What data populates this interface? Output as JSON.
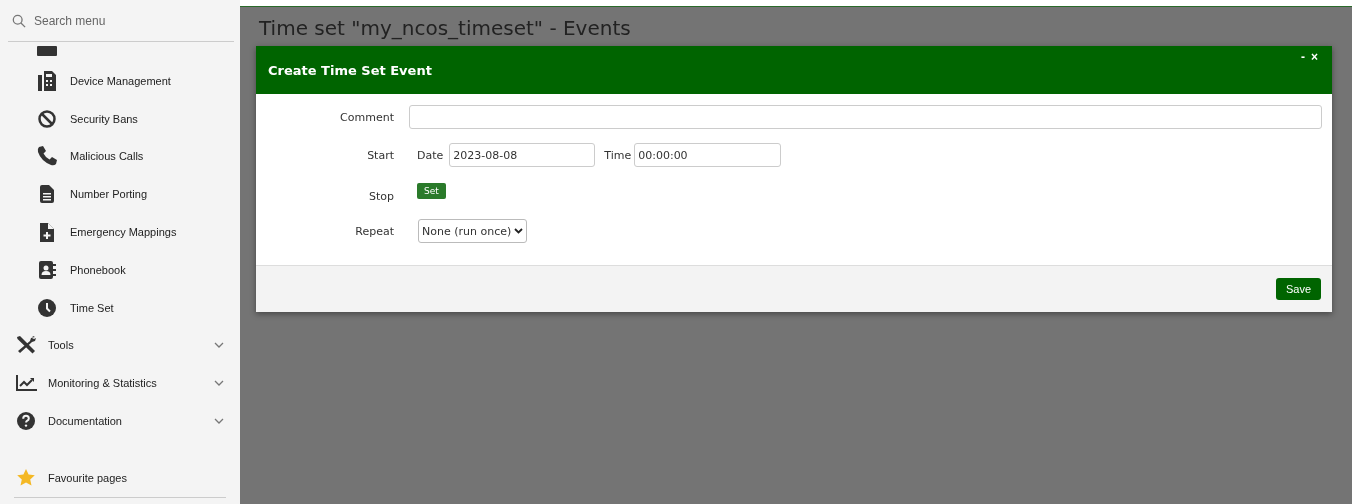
{
  "sidebar": {
    "search": {
      "placeholder": "Search menu"
    },
    "items": [
      {
        "kind": "sub",
        "label": "Device Management"
      },
      {
        "kind": "sub",
        "label": "Security Bans"
      },
      {
        "kind": "sub",
        "label": "Malicious Calls"
      },
      {
        "kind": "sub",
        "label": "Number Porting"
      },
      {
        "kind": "sub",
        "label": "Emergency Mappings"
      },
      {
        "kind": "sub",
        "label": "Phonebook"
      },
      {
        "kind": "sub",
        "label": "Time Set"
      },
      {
        "kind": "group",
        "label": "Tools",
        "expanded": false
      },
      {
        "kind": "group",
        "label": "Monitoring & Statistics",
        "expanded": false
      },
      {
        "kind": "group",
        "label": "Documentation",
        "expanded": false
      }
    ],
    "favourites": "Favourite pages"
  },
  "page_title": "Time set \"my_ncos_timeset\" - Events",
  "dialog": {
    "title": "Create Time Set Event",
    "minimize": "-",
    "close": "×",
    "fields": {
      "comment": {
        "label": "Comment"
      },
      "start": {
        "label": "Start",
        "date_label": "Date",
        "date": "2023-08-08",
        "time_label": "Time",
        "time": "00:00:00"
      },
      "stop": {
        "label": "Stop",
        "button": "Set"
      },
      "repeat": {
        "label": "Repeat",
        "value": "None (run once)"
      }
    },
    "save": "Save"
  }
}
